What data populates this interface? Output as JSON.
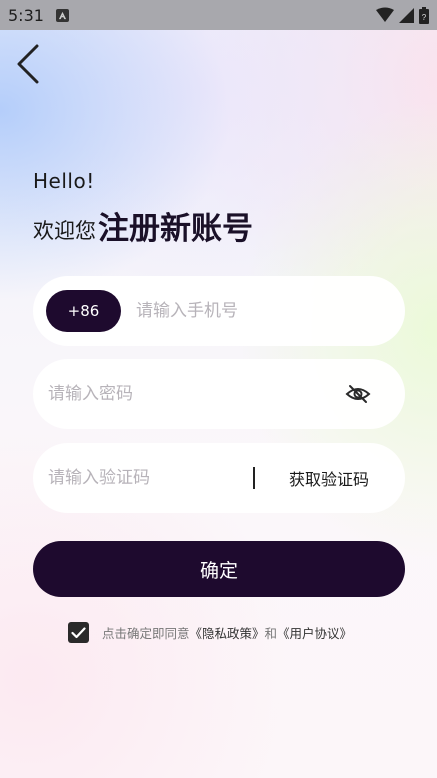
{
  "status_bar": {
    "time": "5:31"
  },
  "heading": {
    "hello": "Hello!",
    "welcome_prefix": "欢迎您",
    "welcome_main": "注册新账号"
  },
  "form": {
    "country_code": "+86",
    "phone_placeholder": "请输入手机号",
    "password_placeholder": "请输入密码",
    "code_placeholder": "请输入验证码",
    "get_code_label": "获取验证码"
  },
  "confirm_label": "确定",
  "agreement": {
    "checked": true,
    "prefix": "点击确定即同意",
    "privacy_link": "《隐私政策》",
    "conjunction": "和",
    "user_agreement_link": "《用户协议》"
  },
  "icons": {
    "back": "chevron-left-icon",
    "password_visibility": "eye-off-icon",
    "status": [
      "a-notification-icon",
      "wifi-icon",
      "cell-signal-icon",
      "battery-icon"
    ]
  },
  "colors": {
    "primary_dark": "#1e0a2e",
    "status_bar": "#a8a8ad"
  }
}
